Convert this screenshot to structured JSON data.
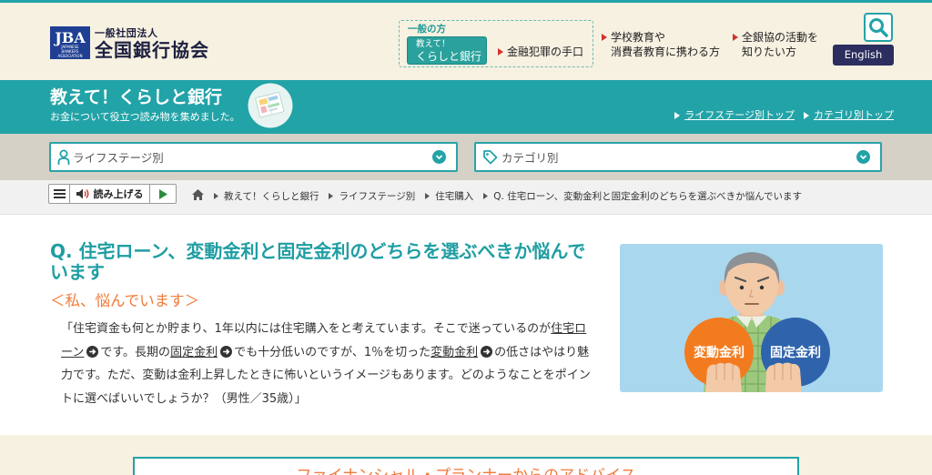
{
  "header": {
    "logo": {
      "mark": "JBA",
      "mark_sub": [
        "JAPANESE",
        "BANKERS",
        "ASSOCIATION"
      ],
      "org_type": "一般社団法人",
      "org_name": "全国銀行協会"
    },
    "audience": {
      "label": "一般の方",
      "current_line1": "教えて！",
      "current_line2": "くらしと銀行",
      "link": "金融犯罪の手口"
    },
    "nav": [
      {
        "line1": "学校教育や",
        "line2": "消費者教育に携わる方"
      },
      {
        "line1": "全銀協の活動を",
        "line2": "知りたい方"
      }
    ],
    "search_icon": "search-icon",
    "language_button": "English"
  },
  "banner": {
    "title": "教えて！くらしと銀行",
    "subtitle": "お金について役立つ読み物を集めました。",
    "links": [
      "ライフステージ別トップ",
      "カテゴリ別トップ"
    ]
  },
  "filters": [
    {
      "label": "ライフステージ別",
      "icon": "person-icon"
    },
    {
      "label": "カテゴリ別",
      "icon": "tag-icon"
    }
  ],
  "reader_toolbar": {
    "menu_icon": "menu-icon",
    "speaker_icon": "speaker-icon",
    "label": "読み上げる",
    "play_icon": "play-icon"
  },
  "breadcrumb": {
    "home_icon": "home-icon",
    "items": [
      "教えて！くらしと銀行",
      "ライフステージ別",
      "住宅購入",
      "Q. 住宅ローン、変動金利と固定金利のどちらを選ぶべきか悩んでいます"
    ]
  },
  "article": {
    "title": "Q. 住宅ローン、変動金利と固定金利のどちらを選ぶべきか悩んでいます",
    "subheading": "＜私、悩んでいます＞",
    "body": [
      "「住宅資金も何とか貯まり、1年以内には住宅購入をと考えています。そこで迷っているのが",
      "住宅ローン",
      "です。長期の",
      "固定金利",
      "でも十分低いのですが、1％を切った",
      "変動金利",
      "の低さはやはり魅力です。ただ、変動は金利上昇したときに怖いというイメージもあります。どのようなことをポイントに選べばいいでしょうか？（男性／35歳）」"
    ],
    "illustration": {
      "left_label": "変動金利",
      "right_label": "固定金利"
    }
  },
  "advice": {
    "title": "ファイナンシャル・プランナーからのアドバイス"
  },
  "colors": {
    "teal": "#22a3a7",
    "navy": "#2b2e5e",
    "orange": "#f07a3a",
    "beige": "#f7f1e2",
    "filter_band": "#d5d1c6",
    "variable_rate": "#f37b1f",
    "fixed_rate": "#2f64ad"
  }
}
